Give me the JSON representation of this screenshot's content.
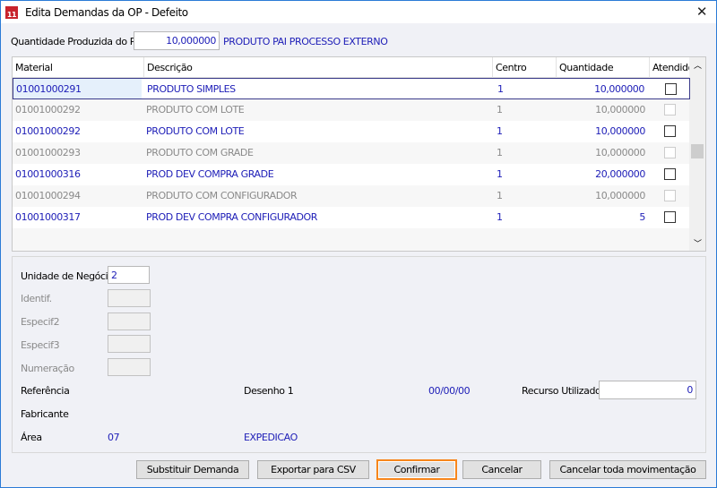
{
  "window": {
    "title": "Edita Demandas da OP - Defeito",
    "close": "✕",
    "logo_text": "11"
  },
  "header": {
    "qty_label": "Quantidade Produzida do Pai",
    "qty_value": "10,000000",
    "product_name": "PRODUTO PAI PROCESSO EXTERNO"
  },
  "grid": {
    "columns": [
      "Material",
      "Descrição",
      "Centro Armaz.",
      "Quantidade",
      "Atendido"
    ],
    "rows": [
      {
        "material": "01001000291",
        "descricao": "PRODUTO SIMPLES",
        "centro": "1",
        "quantidade": "10,000000",
        "atendido": false,
        "enabled": true,
        "selected": true
      },
      {
        "material": "01001000292",
        "descricao": "PRODUTO COM LOTE",
        "centro": "1",
        "quantidade": "10,000000",
        "atendido": false,
        "enabled": false
      },
      {
        "material": "01001000292",
        "descricao": "PRODUTO COM LOTE",
        "centro": "1",
        "quantidade": "10,000000",
        "atendido": false,
        "enabled": true
      },
      {
        "material": "01001000293",
        "descricao": "PRODUTO COM GRADE",
        "centro": "1",
        "quantidade": "10,000000",
        "atendido": false,
        "enabled": false
      },
      {
        "material": "01001000316",
        "descricao": "PROD DEV COMPRA GRADE",
        "centro": "1",
        "quantidade": "20,000000",
        "atendido": false,
        "enabled": true
      },
      {
        "material": "01001000294",
        "descricao": "PRODUTO COM CONFIGURADOR",
        "centro": "1",
        "quantidade": "10,000000",
        "atendido": false,
        "enabled": false
      },
      {
        "material": "01001000317",
        "descricao": "PROD DEV COMPRA CONFIGURADOR",
        "centro": "1",
        "quantidade": "5",
        "atendido": false,
        "enabled": true
      }
    ]
  },
  "details": {
    "unidade_label": "Unidade de Negócio",
    "unidade_value": "2",
    "identif_label": "Identif.",
    "especif2_label": "Especif2",
    "especif3_label": "Especif3",
    "numeracao_label": "Numeração",
    "referencia_label": "Referência",
    "desenho_label": "Desenho 1",
    "date_value": "00/00/00",
    "recurso_label": "Recurso Utilizado",
    "recurso_value": "0",
    "fabricante_label": "Fabricante",
    "area_label": "Área",
    "area_code": "07",
    "area_name": "EXPEDICAO"
  },
  "buttons": {
    "substituir": "Substituir Demanda",
    "exportar": "Exportar para CSV",
    "confirmar": "Confirmar",
    "cancelar": "Cancelar",
    "cancelar_toda": "Cancelar toda movimentação"
  },
  "colors": {
    "accent": "#2020b8",
    "focus": "#f7861c"
  }
}
